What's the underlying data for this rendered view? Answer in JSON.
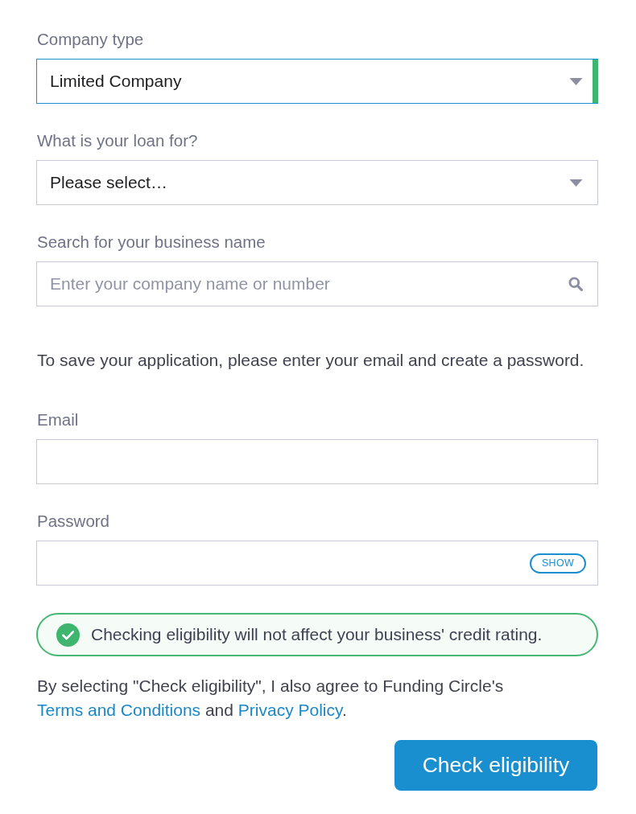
{
  "business_fields": [
    {
      "kind": "select",
      "label": "Company type",
      "value": "Limited Company",
      "focused": true,
      "valid": true
    },
    {
      "kind": "select",
      "label": "What is your loan for?",
      "value": "Please select…",
      "focused": false,
      "valid": false
    },
    {
      "kind": "search",
      "label": "Search for your business name",
      "placeholder": "Enter your company name or number",
      "focused": false,
      "valid": false
    }
  ],
  "save_prompt": "To save your application, please enter your email and create a password.",
  "account_fields": [
    {
      "kind": "email",
      "label": "Email"
    },
    {
      "kind": "password",
      "label": "Password",
      "toggle_button": "SHOW"
    }
  ],
  "notice": {
    "text": "Checking eligibility will not affect your business' credit rating."
  },
  "agreement": [
    {
      "kind": "text",
      "text": "By selecting \"Check eligibility\", I also agree to Funding Circle's "
    },
    {
      "kind": "link",
      "text": "Terms and Conditions"
    },
    {
      "kind": "text",
      "text": " and "
    },
    {
      "kind": "link",
      "text": "Privacy Policy"
    },
    {
      "kind": "text",
      "text": "."
    }
  ],
  "submit_button": "Check eligibility"
}
